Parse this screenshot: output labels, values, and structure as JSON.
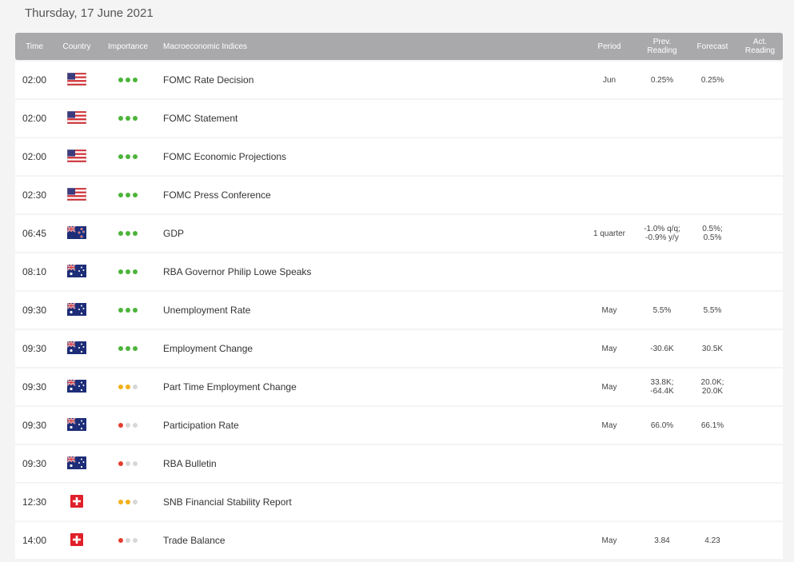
{
  "header": {
    "date": "Thursday, 17 June 2021"
  },
  "columns": {
    "time": "Time",
    "country": "Country",
    "importance": "Importance",
    "name": "Macroeconomic Indices",
    "period": "Period",
    "prev_l1": "Prev.",
    "prev_l2": "Reading",
    "forecast": "Forecast",
    "act_l1": "Act.",
    "act_l2": "Reading"
  },
  "colors": {
    "high": "#4cb43a",
    "medium": "#f2b01b",
    "low": "#e53d2f",
    "inactive": "#d7d7d7",
    "header_bg": "#a9a9ab"
  },
  "rows": [
    {
      "time": "02:00",
      "country": "us-flag-icon",
      "importance": "high",
      "name": "FOMC Rate Decision",
      "period": "Jun",
      "prev1": "0.25%",
      "prev2": "",
      "fore1": "0.25%",
      "fore2": "",
      "actual": ""
    },
    {
      "time": "02:00",
      "country": "us-flag-icon",
      "importance": "high",
      "name": "FOMC Statement",
      "period": "",
      "prev1": "",
      "prev2": "",
      "fore1": "",
      "fore2": "",
      "actual": ""
    },
    {
      "time": "02:00",
      "country": "us-flag-icon",
      "importance": "high",
      "name": "FOMC Economic Projections",
      "period": "",
      "prev1": "",
      "prev2": "",
      "fore1": "",
      "fore2": "",
      "actual": ""
    },
    {
      "time": "02:30",
      "country": "us-flag-icon",
      "importance": "high",
      "name": "FOMC Press Conference",
      "period": "",
      "prev1": "",
      "prev2": "",
      "fore1": "",
      "fore2": "",
      "actual": ""
    },
    {
      "time": "06:45",
      "country": "nz-flag-icon",
      "importance": "high",
      "name": "GDP",
      "period": "1 quarter",
      "prev1": "-1.0% q/q;",
      "prev2": "-0.9% y/y",
      "fore1": "0.5%;",
      "fore2": "0.5%",
      "actual": ""
    },
    {
      "time": "08:10",
      "country": "au-flag-icon",
      "importance": "high",
      "name": "RBA Governor Philip Lowe Speaks",
      "period": "",
      "prev1": "",
      "prev2": "",
      "fore1": "",
      "fore2": "",
      "actual": ""
    },
    {
      "time": "09:30",
      "country": "au-flag-icon",
      "importance": "high",
      "name": "Unemployment Rate",
      "period": "May",
      "prev1": "5.5%",
      "prev2": "",
      "fore1": "5.5%",
      "fore2": "",
      "actual": ""
    },
    {
      "time": "09:30",
      "country": "au-flag-icon",
      "importance": "high",
      "name": "Employment Change",
      "period": "May",
      "prev1": "-30.6K",
      "prev2": "",
      "fore1": "30.5K",
      "fore2": "",
      "actual": ""
    },
    {
      "time": "09:30",
      "country": "au-flag-icon",
      "importance": "medium",
      "name": "Part Time Employment Change",
      "period": "May",
      "prev1": "33.8K;",
      "prev2": "-64.4K",
      "fore1": "20.0K;",
      "fore2": "20.0K",
      "actual": ""
    },
    {
      "time": "09:30",
      "country": "au-flag-icon",
      "importance": "low",
      "name": "Participation Rate",
      "period": "May",
      "prev1": "66.0%",
      "prev2": "",
      "fore1": "66.1%",
      "fore2": "",
      "actual": ""
    },
    {
      "time": "09:30",
      "country": "au-flag-icon",
      "importance": "low",
      "name": "RBA Bulletin",
      "period": "",
      "prev1": "",
      "prev2": "",
      "fore1": "",
      "fore2": "",
      "actual": ""
    },
    {
      "time": "12:30",
      "country": "ch-flag-icon",
      "importance": "medium",
      "name": "SNB Financial Stability Report",
      "period": "",
      "prev1": "",
      "prev2": "",
      "fore1": "",
      "fore2": "",
      "actual": ""
    },
    {
      "time": "14:00",
      "country": "ch-flag-icon",
      "importance": "low",
      "name": "Trade Balance",
      "period": "May",
      "prev1": "3.84",
      "prev2": "",
      "fore1": "4.23",
      "fore2": "",
      "actual": ""
    }
  ]
}
